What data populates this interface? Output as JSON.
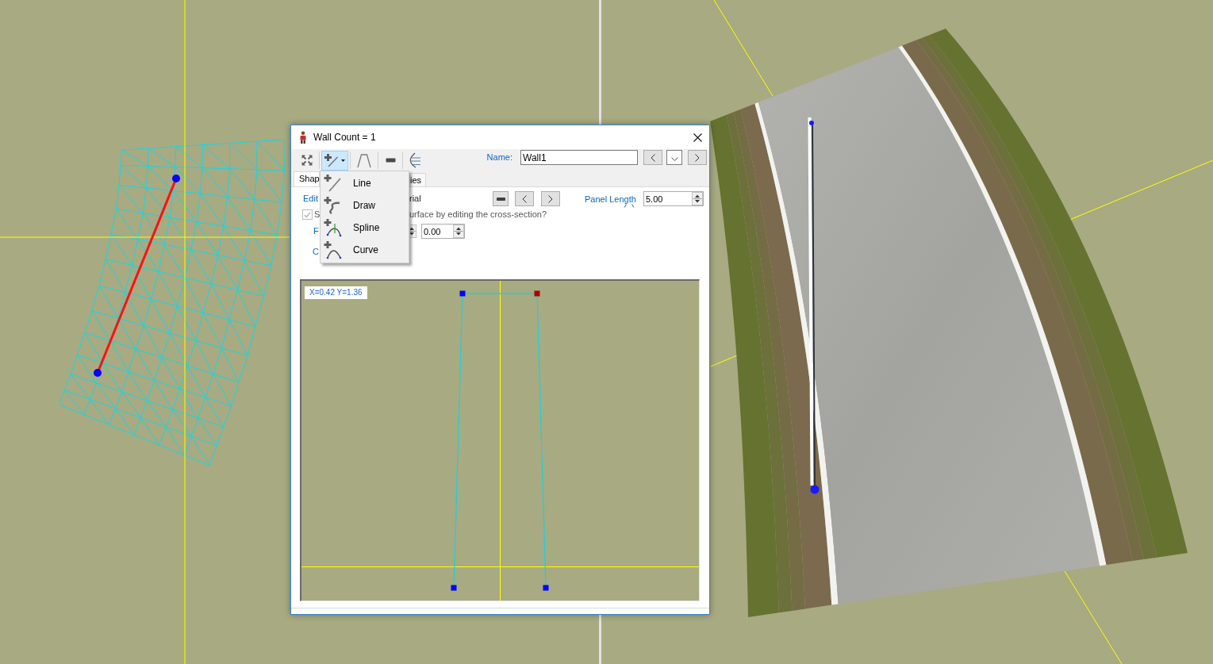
{
  "dialog": {
    "title": "Wall Count = 1",
    "toolbar": {
      "tools": [
        {
          "kind": "fit",
          "selected": false
        },
        {
          "kind": "add_line",
          "selected": true
        },
        {
          "kind": "profile",
          "selected": false
        },
        {
          "kind": "remove",
          "selected": false
        },
        {
          "kind": "curves",
          "selected": false
        }
      ],
      "name_label": "Name:",
      "name_value": "Wall1"
    },
    "tabs": [
      {
        "label": "Shap",
        "selected": true
      },
      {
        "label": "ies",
        "selected": false
      }
    ],
    "edit_link": "Edit",
    "material_label": "rial",
    "panel_length": {
      "label": "Panel Length",
      "value": "5.00"
    },
    "surface_option": {
      "checked": true,
      "disabled": true,
      "label_start": "S",
      "label_end": "urface by editing the cross-section?"
    },
    "row_3": {
      "label": "F",
      "value": "0.00"
    },
    "row_4": {
      "label": "C"
    },
    "cross_section": {
      "readout": "X=0.42 Y=1.36",
      "points": [
        {
          "selected": false
        },
        {
          "selected": true
        },
        {
          "selected": false
        },
        {
          "selected": false
        }
      ]
    }
  },
  "menu": {
    "items": [
      {
        "kind": "line",
        "label": "Line"
      },
      {
        "kind": "draw",
        "label": "Draw"
      },
      {
        "kind": "spline",
        "label": "Spline"
      },
      {
        "kind": "curve",
        "label": "Curve"
      }
    ]
  }
}
